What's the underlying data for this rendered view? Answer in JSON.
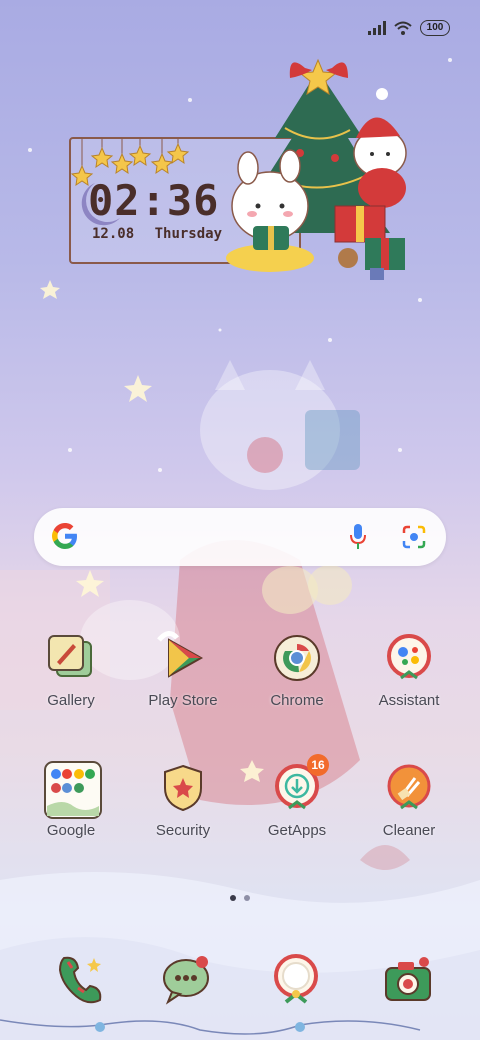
{
  "status": {
    "battery": "100"
  },
  "clock": {
    "time": "02:36",
    "date": "12.08",
    "day": "Thursday"
  },
  "apps_row1": [
    {
      "label": "Gallery"
    },
    {
      "label": "Play Store"
    },
    {
      "label": "Chrome"
    },
    {
      "label": "Assistant"
    }
  ],
  "apps_row2": [
    {
      "label": "Google"
    },
    {
      "label": "Security"
    },
    {
      "label": "GetApps",
      "badge": "16"
    },
    {
      "label": "Cleaner"
    }
  ],
  "pager": {
    "pages": 2,
    "current": 1
  },
  "dock": [
    {
      "icon": "phone-icon"
    },
    {
      "icon": "messages-icon"
    },
    {
      "icon": "browser-icon"
    },
    {
      "icon": "camera-icon"
    }
  ]
}
